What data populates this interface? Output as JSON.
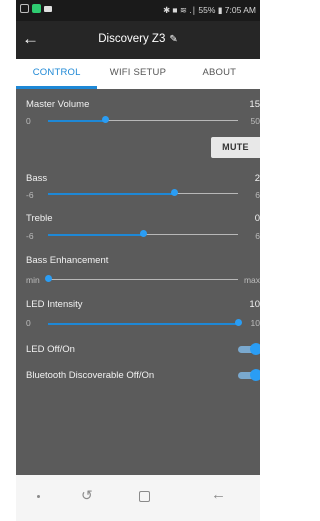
{
  "status_bar": {
    "right_text": "✱ ■ ≋ .∣ 55% ▮ 7:05 AM"
  },
  "app_bar": {
    "back_icon": "arrow-left-icon",
    "title": "Discovery Z3",
    "edit_icon": "pencil-icon"
  },
  "tabs": [
    {
      "label": "CONTROL",
      "active": true
    },
    {
      "label": "WIFI SETUP",
      "active": false
    },
    {
      "label": "ABOUT",
      "active": false
    }
  ],
  "controls": {
    "master_volume": {
      "label": "Master Volume",
      "value": "15",
      "min": "0",
      "max": "50",
      "fraction": 0.3
    },
    "mute_label": "MUTE",
    "bass": {
      "label": "Bass",
      "value": "2",
      "min": "-6",
      "max": "6",
      "fraction": 0.667
    },
    "treble": {
      "label": "Treble",
      "value": "0",
      "min": "-6",
      "max": "6",
      "fraction": 0.5
    },
    "bass_enhancement": {
      "label": "Bass Enhancement",
      "min": "min",
      "max": "max",
      "fraction": 0.0
    },
    "led_intensity": {
      "label": "LED Intensity",
      "value": "10",
      "min": "0",
      "max": "10",
      "fraction": 1.0
    },
    "led_toggle": {
      "label": "LED Off/On",
      "on": true
    },
    "bt_toggle": {
      "label": "Bluetooth Discoverable Off/On",
      "on": true
    }
  },
  "colors": {
    "accent": "#1e88d6",
    "background": "#5b5b5b",
    "app_bar": "#262626"
  }
}
